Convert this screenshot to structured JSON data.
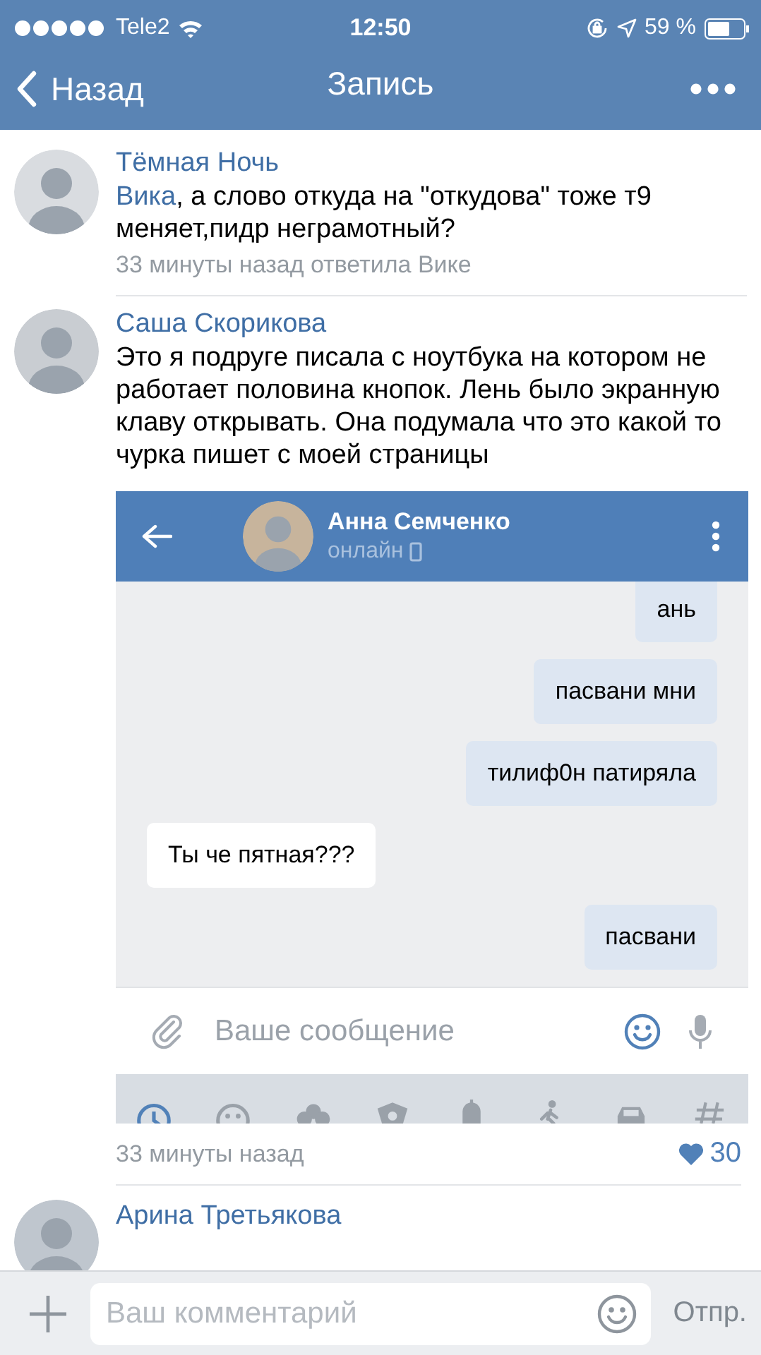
{
  "status_bar": {
    "carrier": "Tele2",
    "time": "12:50",
    "battery": "59 %"
  },
  "nav": {
    "back": "Назад",
    "title": "Запись"
  },
  "comments": [
    {
      "author": "Тёмная Ночь",
      "reply_to": "Вика",
      "text": ", а слово откуда на \"откудова\" тоже т9 меняет,пидр неграмотный?",
      "meta": "33 минуты назад ответила Вике"
    },
    {
      "author": "Саша Скорикова",
      "text": "Это я подруге писала с ноутбука на котором не работает половина кнопок. Лень было экранную клаву открывать. Она подумала что это какой то чурка пишет с моей страницы",
      "attachment": {
        "contact": "Анна Семченко",
        "status": "онлайн",
        "messages": [
          {
            "text": "ань",
            "outgoing": true
          },
          {
            "text": "пасвани мни",
            "outgoing": true
          },
          {
            "text": "тилиф0н патиряла",
            "outgoing": true
          },
          {
            "text": "Ты че пятная???",
            "outgoing": false
          },
          {
            "text": "пасвани",
            "outgoing": true
          }
        ],
        "placeholder": "Ваше сообщение",
        "sticker_tabs": [
          {
            "kind": "clock",
            "selected": true
          },
          {
            "kind": "smile",
            "selected": false
          },
          {
            "kind": "flower",
            "selected": false
          },
          {
            "kind": "ball",
            "selected": false
          },
          {
            "kind": "bell",
            "selected": false
          },
          {
            "kind": "walker",
            "selected": false
          },
          {
            "kind": "car",
            "selected": false
          },
          {
            "kind": "hash",
            "selected": false
          }
        ]
      },
      "time": "33 минуты назад",
      "likes": "30",
      "liked": true
    },
    {
      "author": "Арина Третьякова"
    }
  ],
  "comment_bar": {
    "placeholder": "Ваш комментарий",
    "send": "Отпр."
  }
}
